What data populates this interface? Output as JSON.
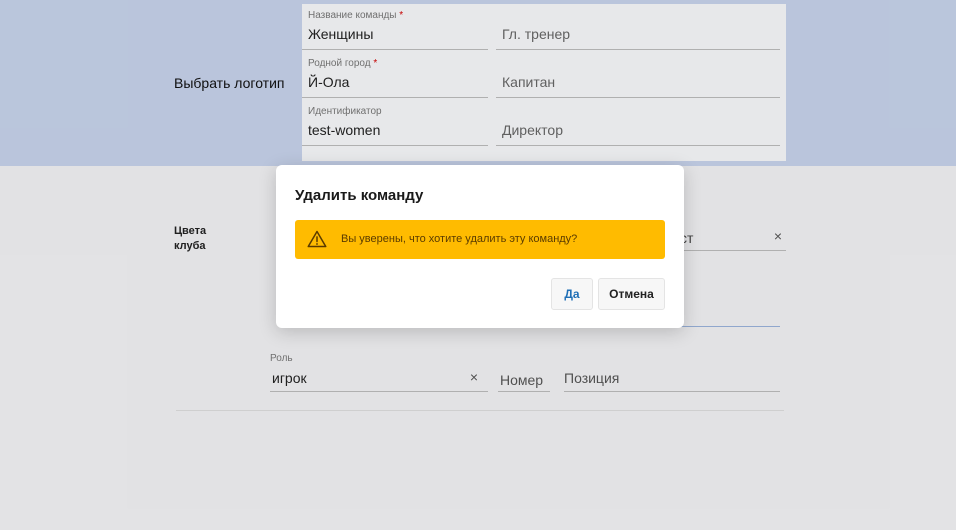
{
  "hero": {
    "logo_label": "Выбрать логотип"
  },
  "form": {
    "team_name": {
      "label": "Название команды",
      "value": "Женщины"
    },
    "head_coach": {
      "placeholder": "Гл. тренер"
    },
    "home_city": {
      "label": "Родной город",
      "value": "Й-Ола"
    },
    "captain": {
      "placeholder": "Капитан"
    },
    "identifier": {
      "label": "Идентификатор",
      "value": "test-women"
    },
    "director": {
      "placeholder": "Директор"
    },
    "required_mark": "*"
  },
  "colors": {
    "label": "Цвета клуба"
  },
  "partial_field": {
    "text": "ст",
    "clear": "×"
  },
  "member": {
    "role_label": "Роль",
    "role_value": "игрок",
    "role_clear": "×",
    "number_placeholder": "Номер",
    "position_placeholder": "Позиция"
  },
  "dialog": {
    "title": "Удалить команду",
    "message": "Вы уверены, что хотите удалить эту команду?",
    "icon": "warning-icon",
    "yes_label": "Да",
    "cancel_label": "Отмена"
  },
  "colors_palette": {
    "hero_bg": "#c6d2ea",
    "alert_bg": "#ffbb00",
    "yes_text": "#1f6fb6"
  }
}
